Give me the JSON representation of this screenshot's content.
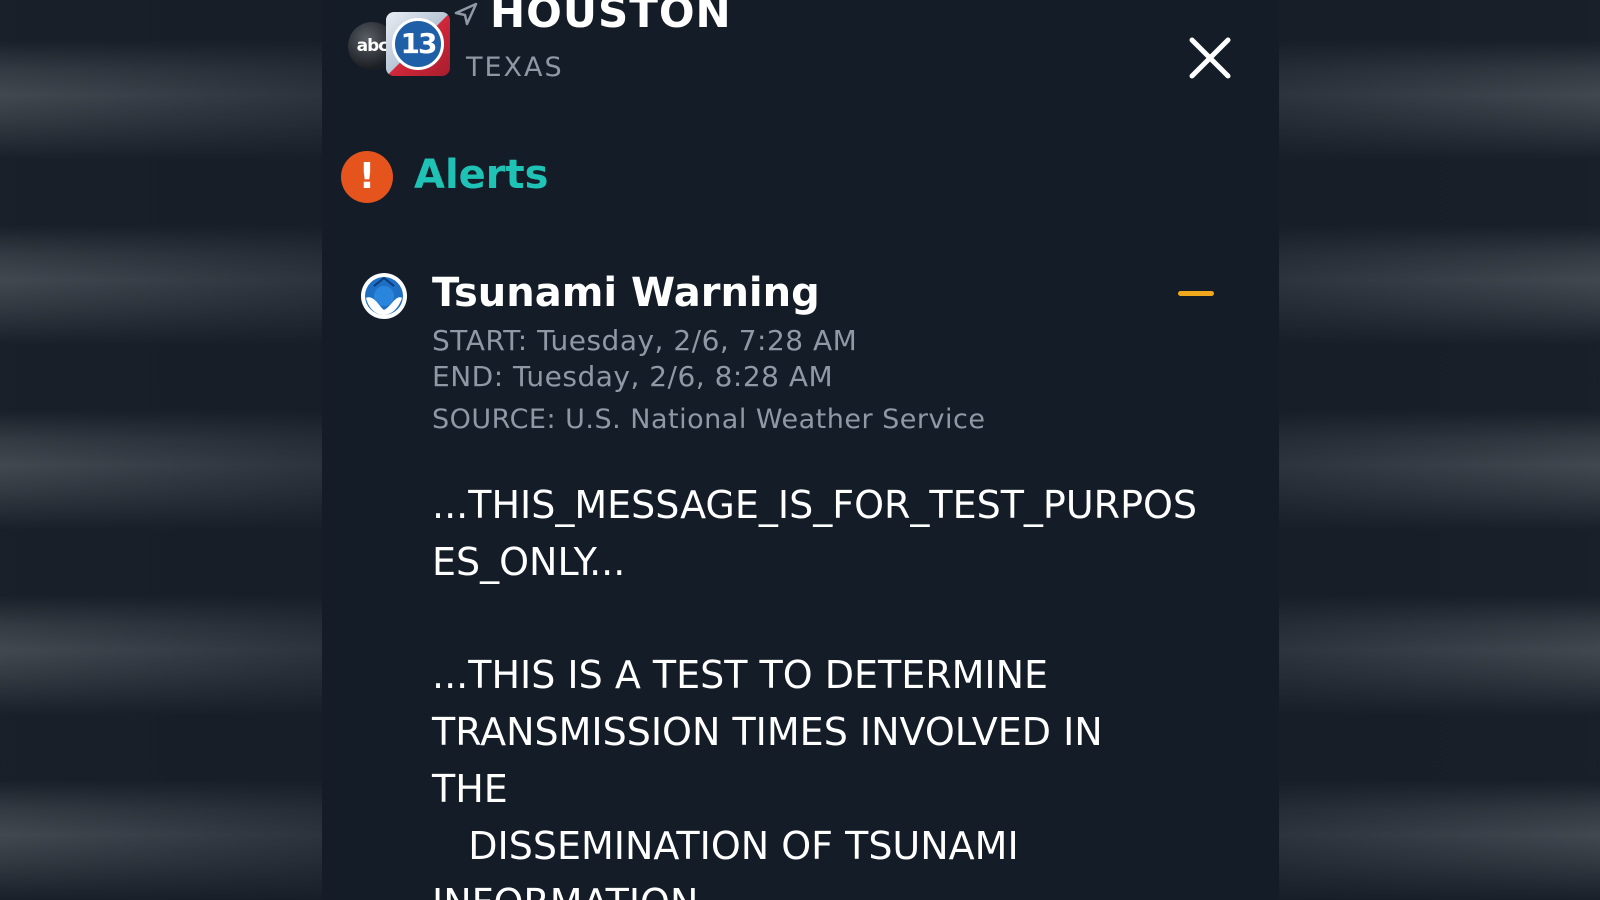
{
  "header": {
    "logo_abc": "abc",
    "logo_number": "13",
    "city": "HOUSTON",
    "state": "TEXAS"
  },
  "alerts": {
    "title": "Alerts",
    "icon_glyph": "!"
  },
  "alert": {
    "title": "Tsunami Warning",
    "start": "START: Tuesday, 2/6, 7:28 AM",
    "end": "END: Tuesday, 2/6, 8:28 AM",
    "source": "SOURCE: U.S. National Weather Service",
    "message_lines": [
      "...THIS_MESSAGE_IS_FOR_TEST_PURPOS",
      "ES_ONLY...",
      "",
      "...THIS IS A TEST TO DETERMINE",
      "TRANSMISSION TIMES INVOLVED IN",
      "THE",
      "   DISSEMINATION OF TSUNAMI",
      "INFORMATION..."
    ]
  },
  "colors": {
    "panel": "#141c27",
    "accent_teal": "#1ec3b6",
    "alert_orange": "#e4541c",
    "collapse_yellow": "#f2a81d",
    "muted_text": "#8f99a6"
  },
  "icons": {
    "close": "close-icon",
    "location": "location-arrow-icon",
    "noaa": "noaa-logo-icon",
    "collapse": "minus-icon"
  }
}
